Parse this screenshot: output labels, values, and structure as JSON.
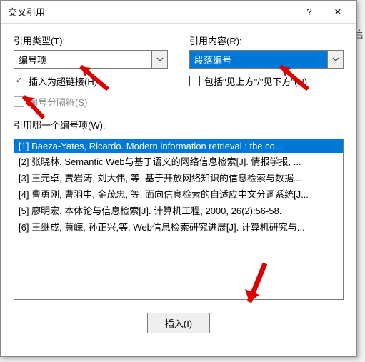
{
  "dialog": {
    "title": "交叉引用",
    "help_icon": "?",
    "close_icon": "✕"
  },
  "labels": {
    "ref_type": "引用类型(T):",
    "ref_content": "引用内容(R):",
    "as_hyperlink": "插入为超链接(H)",
    "include_above_below": "包括\"见上方\"/\"见下方\"(N)",
    "number_separator": "编号分隔符(S)",
    "which_item": "引用哪一个编号项(W):"
  },
  "values": {
    "ref_type": "编号项",
    "ref_content": "段落编号"
  },
  "checkboxes": {
    "as_hyperlink": true,
    "include_above_below": false,
    "number_separator": false
  },
  "list_items": [
    "[1] Baeza-Yates, Ricardo. Modern information retrieval : the co...",
    "[2] 张晓林. Semantic Web与基于语义的网络信息检索[J]. 情报学报, ...",
    "[3] 王元卓, 贾岩涛, 刘大伟, 等. 基于开放网络知识的信息检索与数据...",
    "[4] 曹勇刚, 曹羽中, 金茂忠, 等. 面向信息检索的自适应中文分词系统[J...",
    "[5] 廖明宏. 本体论与信息检索[J]. 计算机工程, 2000, 26(2):56-58.",
    "[6] 王继成, 萧嵘, 孙正兴,等. Web信息检索研究进展[J]. 计算机研究与..."
  ],
  "selected_index": 0,
  "buttons": {
    "insert": "插入(I)"
  },
  "side_text": "言"
}
